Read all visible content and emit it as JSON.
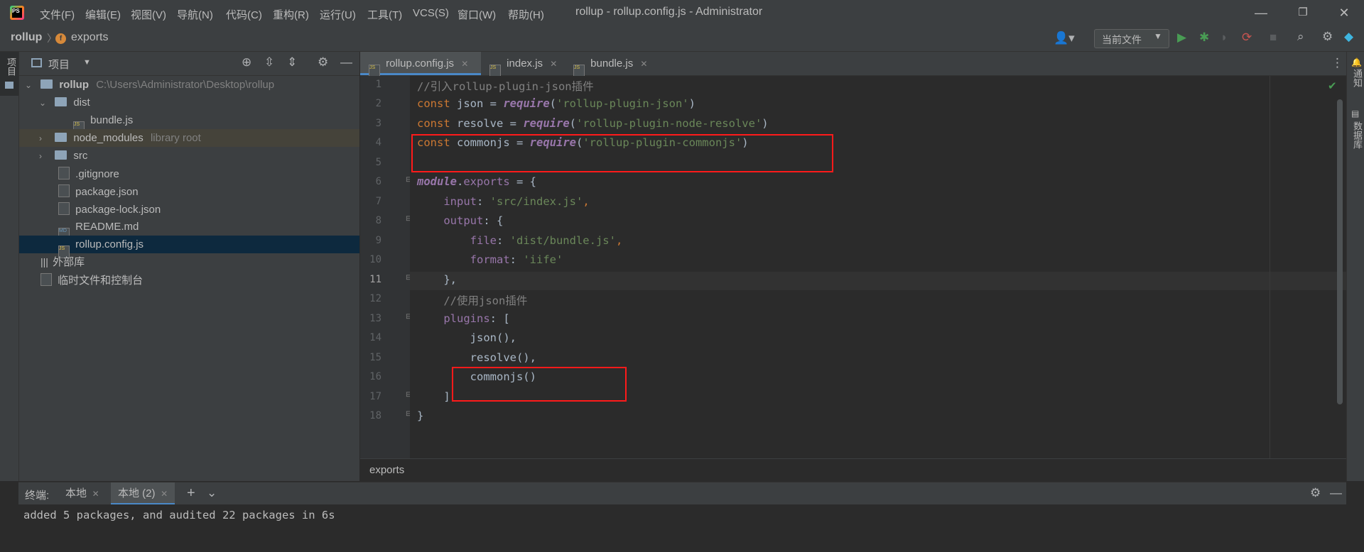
{
  "menu": [
    "文件(F)",
    "编辑(E)",
    "视图(V)",
    "导航(N)",
    "代码(C)",
    "重构(R)",
    "运行(U)",
    "工具(T)",
    "VCS(S)",
    "窗口(W)",
    "帮助(H)"
  ],
  "window_title": "rollup - rollup.config.js - Administrator",
  "nav": {
    "project": "rollup",
    "symbol": "exports",
    "run_config": "当前文件"
  },
  "project_panel": {
    "title": "项目",
    "tree": [
      {
        "name": "rollup",
        "extra": "C:\\Users\\Administrator\\Desktop\\rollup"
      },
      {
        "name": "dist"
      },
      {
        "name": "bundle.js"
      },
      {
        "name": "node_modules",
        "extra": "library root"
      },
      {
        "name": "src"
      },
      {
        "name": ".gitignore"
      },
      {
        "name": "package.json"
      },
      {
        "name": "package-lock.json"
      },
      {
        "name": "README.md"
      },
      {
        "name": "rollup.config.js"
      },
      {
        "name": "外部库"
      },
      {
        "name": "临时文件和控制台"
      }
    ]
  },
  "left_stripe_label": "项目",
  "right_stripe_labels": [
    "通知",
    "数据库"
  ],
  "tabs": [
    "rollup.config.js",
    "index.js",
    "bundle.js"
  ],
  "line_numbers": [
    "1",
    "2",
    "3",
    "4",
    "5",
    "6",
    "7",
    "8",
    "9",
    "10",
    "11",
    "12",
    "13",
    "14",
    "15",
    "16",
    "17",
    "18"
  ],
  "code": {
    "l1": "//引入rollup-plugin-json插件",
    "l2_kw": "const",
    "l2_var": " json = ",
    "l2_fn": "require",
    "l2_p1": "(",
    "l2_str": "'rollup-plugin-json'",
    "l2_p2": ")",
    "l3_kw": "const",
    "l3_var": " resolve = ",
    "l3_fn": "require",
    "l3_p1": "(",
    "l3_str": "'rollup-plugin-node-resolve'",
    "l3_p2": ")",
    "l4_kw": "const",
    "l4_var": " commonjs = ",
    "l4_fn": "require",
    "l4_p1": "(",
    "l4_str": "'rollup-plugin-commonjs'",
    "l4_p2": ")",
    "l6_fn": "module",
    "l6_rest": ".",
    "l6_prop": "exports",
    "l6_end": " = {",
    "l7_prop": "    input",
    "l7_colon": ": ",
    "l7_str": "'src/index.js'",
    "l7_end": ",",
    "l8_prop": "    output",
    "l8_end": ": {",
    "l9_prop": "        file",
    "l9_colon": ": ",
    "l9_str": "'dist/bundle.js'",
    "l9_end": ",",
    "l10_prop": "        format",
    "l10_colon": ": ",
    "l10_str": "'iife'",
    "l11": "    },",
    "l12": "    //使用json插件",
    "l13_prop": "    plugins",
    "l13_end": ": [",
    "l14": "        json(),",
    "l15": "        resolve(),",
    "l16": "        commonjs()",
    "l17": "    ]",
    "l18": "}"
  },
  "editor_breadcrumb": "exports",
  "terminal": {
    "label": "终端:",
    "tabs": [
      "本地",
      "本地 (2)"
    ],
    "lines": [
      "added 5 packages, and audited 22 packages in 6s"
    ]
  },
  "colors": {
    "highlight_box": "#ff1a1a",
    "accent": "#4a88c7"
  }
}
